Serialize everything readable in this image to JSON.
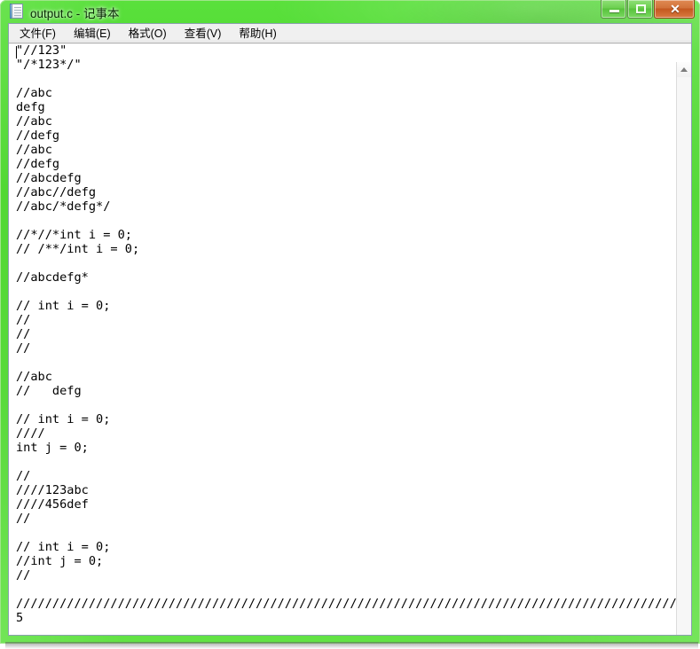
{
  "window": {
    "title": "output.c - 记事本",
    "icon": "notepad-document-icon",
    "frame_color": "#45d625",
    "close_button_color": "#c4581f"
  },
  "caption_buttons": {
    "minimize_label": "—",
    "maximize_label": "□",
    "close_label": "✕"
  },
  "menubar": {
    "items": [
      {
        "label": "文件(F)",
        "name": "menu-file"
      },
      {
        "label": "编辑(E)",
        "name": "menu-edit"
      },
      {
        "label": "格式(O)",
        "name": "menu-format"
      },
      {
        "label": "查看(V)",
        "name": "menu-view"
      },
      {
        "label": "帮助(H)",
        "name": "menu-help"
      }
    ]
  },
  "editor": {
    "content": "\"//123\"\n\"/*123*/\"\n\n//abc\ndefg\n//abc\n//defg\n//abc\n//defg\n//abcdefg\n//abc//defg\n//abc/*defg*/\n\n//*//*int i = 0;\n// /**/int i = 0;\n\n//abcdefg*\n\n// int i = 0;\n//\n//\n//\n\n//abc\n//   defg\n\n// int i = 0;\n////\nint j = 0;\n\n//\n////123abc\n////456def\n//\n\n// int i = 0;\n//int j = 0;\n//\n\n/////////////////////////////////////////////////////////////////////////////////////////////////////////////////////////////////        5"
  },
  "scrollbar": {
    "up_arrow": "scroll-up-arrow",
    "down_arrow": "scroll-down-arrow"
  }
}
